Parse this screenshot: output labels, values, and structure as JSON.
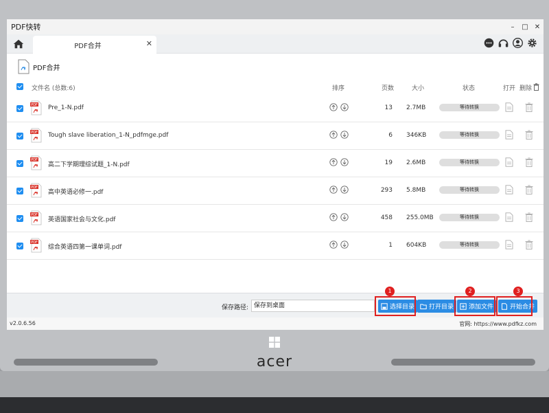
{
  "window": {
    "title": "PDF快转"
  },
  "tabs": [
    {
      "label": "PDF合并"
    }
  ],
  "page": {
    "title": "PDF合并"
  },
  "columns": {
    "filename": "文件名 (总数:6)",
    "sort": "排序",
    "pages": "页数",
    "size": "大小",
    "status": "状态",
    "open": "打开",
    "delete": "删除"
  },
  "files": [
    {
      "name": "Pre_1-N.pdf",
      "pages": "13",
      "size": "2.7MB",
      "status": "等待转换"
    },
    {
      "name": "Tough slave liberation_1-N_pdfmge.pdf",
      "pages": "6",
      "size": "346KB",
      "status": "等待转换"
    },
    {
      "name": "高二下学期理综试题_1-N.pdf",
      "pages": "19",
      "size": "2.6MB",
      "status": "等待转换"
    },
    {
      "name": "高中英语必修一.pdf",
      "pages": "293",
      "size": "5.8MB",
      "status": "等待转换"
    },
    {
      "name": "英语国家社会与文化.pdf",
      "pages": "458",
      "size": "255.0MB",
      "status": "等待转换"
    },
    {
      "name": "综合英语四第一课单词.pdf",
      "pages": "1",
      "size": "604KB",
      "status": "等待转换"
    }
  ],
  "footer": {
    "save_label": "保存路径:",
    "save_value": "保存到桌面",
    "choose_dir": "选择目录",
    "open_dir": "打开目录",
    "add_file": "添加文件",
    "start_merge": "开始合并",
    "badges": [
      "1",
      "2",
      "3"
    ]
  },
  "statusbar": {
    "version": "v2.0.6.56",
    "website": "官网: https://www.pdfkz.com"
  },
  "laptop": {
    "brand": "acer"
  },
  "colors": {
    "accent": "#2b8ce4",
    "highlight": "#e02020",
    "pdf_red": "#d9342b"
  }
}
